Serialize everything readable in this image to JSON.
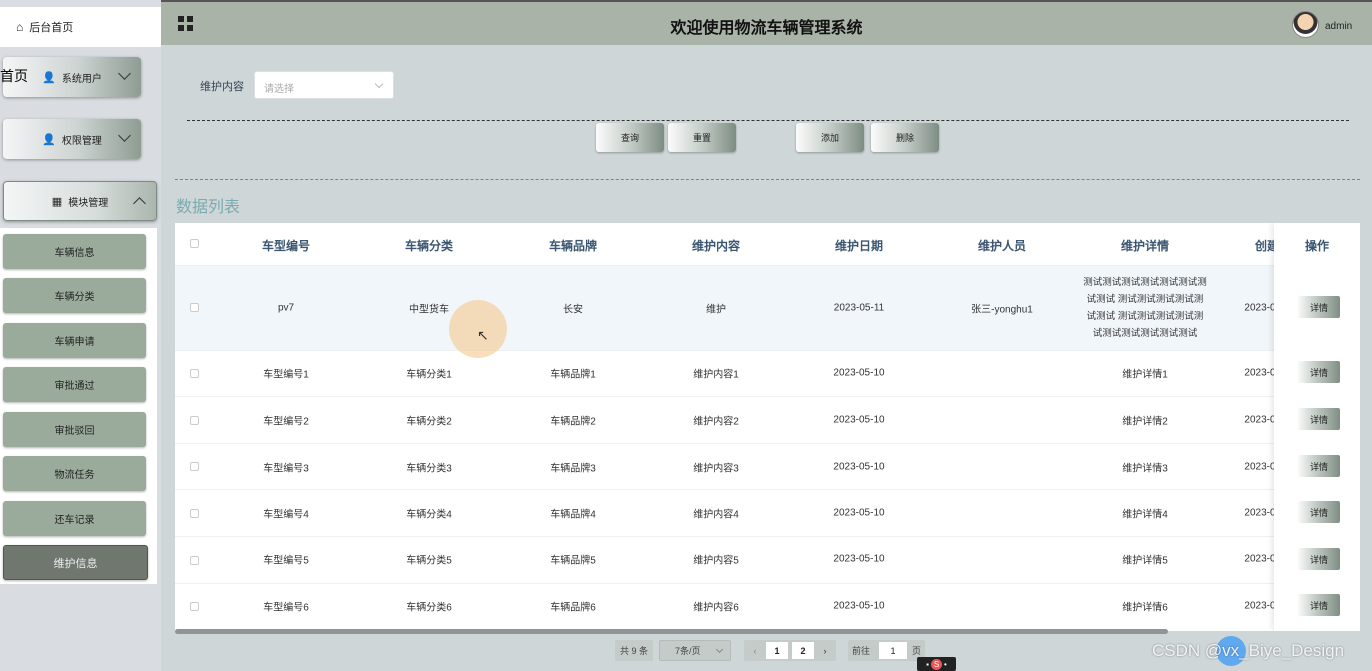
{
  "header": {
    "title": "欢迎使用物流车辆管理系统",
    "username": "admin"
  },
  "sidebar": {
    "home": "后台首页",
    "overlap_text": "首页",
    "menus": [
      {
        "label": "系统用户",
        "icon": "user-icon"
      },
      {
        "label": "权限管理",
        "icon": "user-icon"
      },
      {
        "label": "模块管理",
        "icon": "grid-icon"
      }
    ],
    "submenu": [
      "车辆信息",
      "车辆分类",
      "车辆申请",
      "审批通过",
      "审批驳回",
      "物流任务",
      "还车记录",
      "维护信息"
    ]
  },
  "filter": {
    "label": "维护内容",
    "placeholder": "请选择"
  },
  "actions": {
    "query": "查询",
    "reset": "重置",
    "add": "添加",
    "delete": "删除"
  },
  "section_title": "数据列表",
  "table": {
    "columns": [
      "车型编号",
      "车辆分类",
      "车辆品牌",
      "维护内容",
      "维护日期",
      "维护人员",
      "维护详情",
      "创建",
      "操作"
    ],
    "rows": [
      [
        "pv7",
        "中型货车",
        "长安",
        "维护",
        "2023-05-11",
        "张三-yonghu1",
        "测试测试测试测试测试测试测试测试 测试测试测试测试测试测试 测试测试测试测试测试测试测试测试测试测试",
        "2023-0"
      ],
      [
        "车型编号1",
        "车辆分类1",
        "车辆品牌1",
        "维护内容1",
        "2023-05-10",
        "",
        "维护详情1",
        "2023-0"
      ],
      [
        "车型编号2",
        "车辆分类2",
        "车辆品牌2",
        "维护内容2",
        "2023-05-10",
        "",
        "维护详情2",
        "2023-0"
      ],
      [
        "车型编号3",
        "车辆分类3",
        "车辆品牌3",
        "维护内容3",
        "2023-05-10",
        "",
        "维护详情3",
        "2023-0"
      ],
      [
        "车型编号4",
        "车辆分类4",
        "车辆品牌4",
        "维护内容4",
        "2023-05-10",
        "",
        "维护详情4",
        "2023-0"
      ],
      [
        "车型编号5",
        "车辆分类5",
        "车辆品牌5",
        "维护内容5",
        "2023-05-10",
        "",
        "维护详情5",
        "2023-0"
      ],
      [
        "车型编号6",
        "车辆分类6",
        "车辆品牌6",
        "维护内容6",
        "2023-05-10",
        "",
        "维护详情6",
        "2023-0"
      ]
    ],
    "detail_button": "详情"
  },
  "pagination": {
    "total": "共 9 条",
    "page_size": "7条/页",
    "pages": [
      "1",
      "2"
    ],
    "goto_label": "前往",
    "goto_value": "1",
    "page_suffix": "页"
  },
  "watermark": "CSDN @vx_Biye_Design",
  "ime": "S"
}
